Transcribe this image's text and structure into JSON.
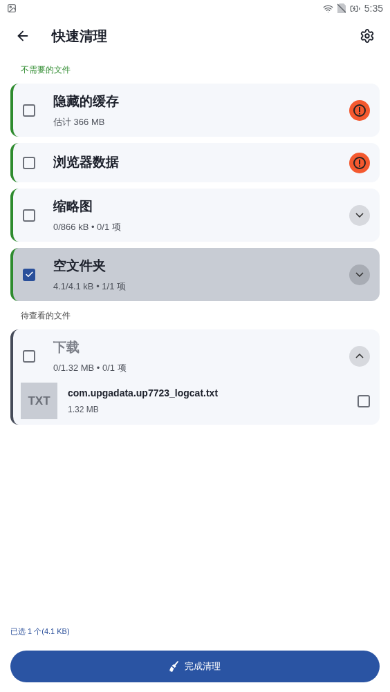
{
  "status_bar": {
    "time": "5:35"
  },
  "toolbar": {
    "title": "快速清理"
  },
  "sections": [
    {
      "label": "不需要的文件",
      "color": "#2e8b2e",
      "groups": [
        {
          "title": "隐藏的缓存",
          "subtitle": "估计 366 MB",
          "checked": false,
          "selected": false,
          "muted": false,
          "kind": "warning"
        },
        {
          "title": "浏览器数据",
          "checked": false,
          "selected": false,
          "muted": false,
          "kind": "warning"
        },
        {
          "title": "缩略图",
          "subtitle": "0/866 kB • 0/1 项",
          "checked": false,
          "selected": false,
          "muted": false,
          "kind": "expand"
        },
        {
          "title": "空文件夹",
          "subtitle": "4.1/4.1 kB • 1/1 项",
          "checked": true,
          "selected": true,
          "muted": false,
          "kind": "expand"
        }
      ]
    },
    {
      "label": "待查看的文件",
      "color": "#454b59",
      "groups": [
        {
          "title": "下载",
          "subtitle": "0/1.32 MB • 0/1 项",
          "checked": false,
          "selected": false,
          "muted": true,
          "kind": "collapse",
          "files": [
            {
              "thumb": "TXT",
              "name": "com.upgadata.up7723_logcat.txt",
              "size": "1.32 MB",
              "checked": false
            }
          ]
        }
      ]
    }
  ],
  "footer": {
    "summary": "已选 1 个(4.1 KB)",
    "button": "完成清理"
  }
}
